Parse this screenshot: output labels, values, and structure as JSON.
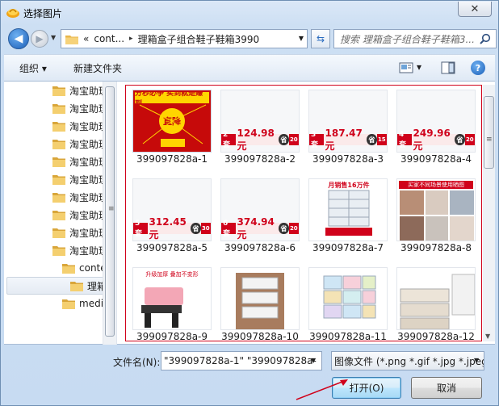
{
  "window": {
    "title": "选择图片",
    "close_glyph": "✕",
    "colors": {
      "accent": "#d0021b",
      "frame": "#c7dbf2"
    }
  },
  "nav": {
    "back_glyph": "◀",
    "forward_glyph": "▶",
    "history_glyph": "▼",
    "address": {
      "crumb_prefix": "«",
      "crumb_1": "cont...",
      "separator": "▸",
      "crumb_2": "理箱盒子组合鞋子鞋箱3990",
      "drop_glyph": "▼"
    },
    "refresh_glyph": "⇆",
    "search_placeholder": "搜索 理箱盒子组合鞋子鞋箱3..."
  },
  "toolbar": {
    "organize": "组织 ▾",
    "new_folder": "新建文件夹",
    "view_drop": "▾",
    "help_glyph": "?"
  },
  "tree": {
    "items": [
      {
        "label": "淘宝助理"
      },
      {
        "label": "淘宝助理"
      },
      {
        "label": "淘宝助理"
      },
      {
        "label": "淘宝助理"
      },
      {
        "label": "淘宝助理"
      },
      {
        "label": "淘宝助理"
      },
      {
        "label": "淘宝助理"
      },
      {
        "label": "淘宝助理"
      },
      {
        "label": "淘宝助理"
      },
      {
        "label": "淘宝助理"
      },
      {
        "label": "content"
      },
      {
        "label": "理箱盒子"
      },
      {
        "label": "media"
      }
    ],
    "grip": "≡"
  },
  "files": [
    {
      "name": "399097828a-1",
      "kind": "poster",
      "text": "分秒必争 买到就是赚到",
      "sub": "直降"
    },
    {
      "name": "399097828a-2",
      "kind": "banner",
      "lead": "2套",
      "price": "124.98元"
    },
    {
      "name": "399097828a-3",
      "kind": "banner",
      "lead": "3套",
      "price": "187.47元"
    },
    {
      "name": "399097828a-4",
      "kind": "banner",
      "lead": "4套",
      "price": "249.96元"
    },
    {
      "name": "399097828a-5",
      "kind": "banner",
      "lead": "5套",
      "price": "312.45元"
    },
    {
      "name": "399097828a-6",
      "kind": "banner",
      "lead": "6套",
      "price": "374.94元"
    },
    {
      "name": "399097828a-7",
      "kind": "product",
      "text": "月销售16万件"
    },
    {
      "name": "399097828a-8",
      "kind": "product",
      "text": "买家不同场景使用晒图"
    },
    {
      "name": "399097828a-9",
      "kind": "product",
      "text": "升级加厚 叠加不变形"
    },
    {
      "name": "399097828a-10",
      "kind": "product",
      "text": ""
    },
    {
      "name": "399097828a-11",
      "kind": "product",
      "text": ""
    },
    {
      "name": "399097828a-12",
      "kind": "product",
      "text": ""
    }
  ],
  "scroll": {
    "grip": "≡",
    "down": "▼"
  },
  "footer": {
    "filename_label": "文件名(N):",
    "filename_value": "\"399097828a-1\" \"399097828a-",
    "filetype_value": "图像文件 (*.png *.gif *.jpg *.jpeg)",
    "drop_glyph": "▼",
    "open_button": "打开(O)",
    "cancel_button": "取消"
  }
}
